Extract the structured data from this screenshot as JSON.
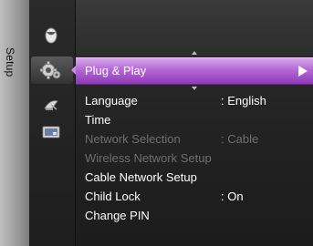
{
  "side_tab": {
    "label": "Setup"
  },
  "icons": [
    {
      "name": "picture-icon"
    },
    {
      "name": "setup-gear-icon"
    },
    {
      "name": "satellite-dish-icon"
    },
    {
      "name": "input-source-icon"
    }
  ],
  "highlighted": {
    "label": "Plug & Play"
  },
  "menu_items": [
    {
      "label": "Language",
      "value": ": English",
      "enabled": true
    },
    {
      "label": "Time",
      "value": "",
      "enabled": true
    },
    {
      "label": "Network Selection",
      "value": ": Cable",
      "enabled": false
    },
    {
      "label": "Wireless Network Setup",
      "value": "",
      "enabled": false
    },
    {
      "label": "Cable Network Setup",
      "value": "",
      "enabled": true
    },
    {
      "label": "Child Lock",
      "value": ": On",
      "enabled": true
    },
    {
      "label": "Change PIN",
      "value": "",
      "enabled": true
    }
  ],
  "colors": {
    "highlight": "#b368d4",
    "text": "#ffffff",
    "disabled_text": "#6f6f6f"
  }
}
